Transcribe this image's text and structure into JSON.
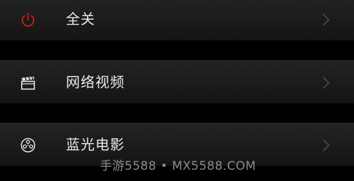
{
  "menu": {
    "items": [
      {
        "label": "全关",
        "icon": "power-icon",
        "icon_color": "#d21a1a"
      },
      {
        "label": "网络视频",
        "icon": "clapperboard-icon",
        "icon_color": "#e6e6e6"
      },
      {
        "label": "蓝光电影",
        "icon": "film-reel-icon",
        "icon_color": "#e6e6e6"
      }
    ],
    "chevron_color": "#4a4a4a"
  },
  "watermark": {
    "text": "手游5588 • MX5588.COM"
  }
}
